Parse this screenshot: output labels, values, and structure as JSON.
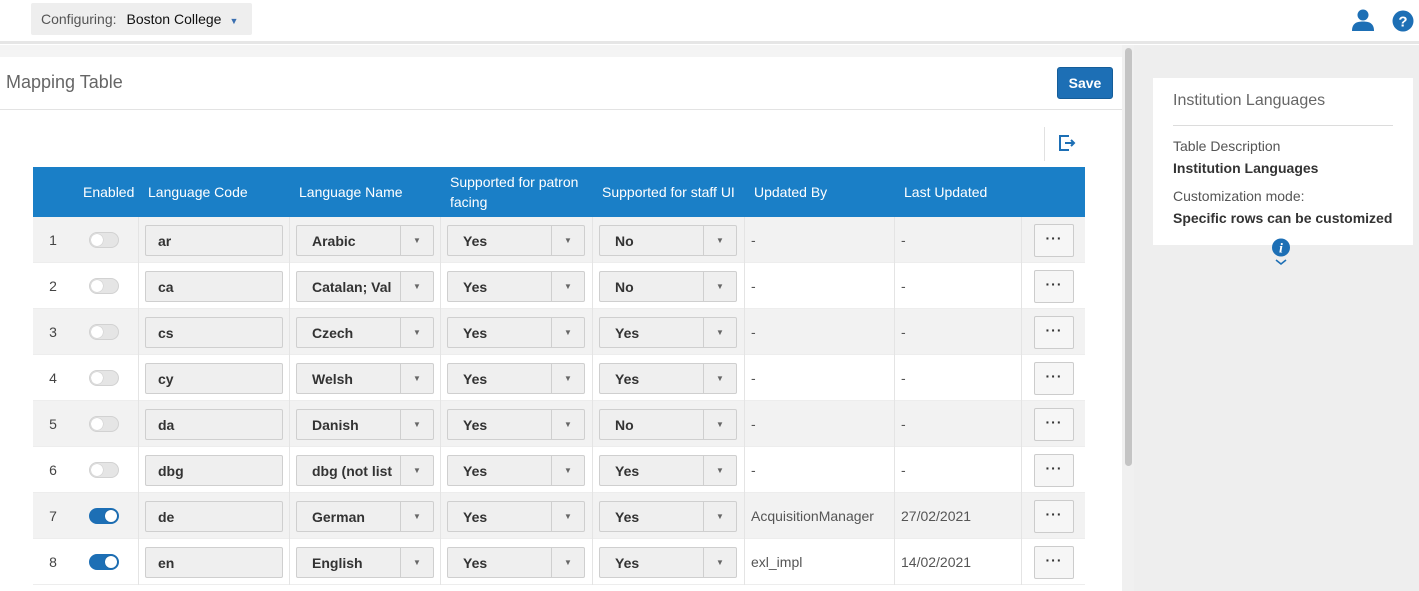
{
  "header": {
    "configuring_label": "Configuring:",
    "configuring_value": "Boston College",
    "caret": "▼",
    "user_icon": "user-icon",
    "help_icon": "help-icon"
  },
  "page": {
    "title": "Mapping Table",
    "save_label": "Save",
    "export_icon": "export-icon"
  },
  "table": {
    "columns": {
      "enabled": "Enabled",
      "code": "Language Code",
      "name": "Language Name",
      "patron": "Supported for patron facing",
      "staff": "Supported for staff UI",
      "updated_by": "Updated By",
      "last_updated": "Last Updated"
    },
    "rows": [
      {
        "num": "1",
        "enabled": false,
        "code": "ar",
        "name": "Arabic",
        "patron": "Yes",
        "staff": "No",
        "updated_by": "-",
        "last_updated": "-",
        "actions": "···"
      },
      {
        "num": "2",
        "enabled": false,
        "code": "ca",
        "name": "Catalan; Val",
        "patron": "Yes",
        "staff": "No",
        "updated_by": "-",
        "last_updated": "-",
        "actions": "···"
      },
      {
        "num": "3",
        "enabled": false,
        "code": "cs",
        "name": "Czech",
        "patron": "Yes",
        "staff": "Yes",
        "updated_by": "-",
        "last_updated": "-",
        "actions": "···"
      },
      {
        "num": "4",
        "enabled": false,
        "code": "cy",
        "name": "Welsh",
        "patron": "Yes",
        "staff": "Yes",
        "updated_by": "-",
        "last_updated": "-",
        "actions": "···"
      },
      {
        "num": "5",
        "enabled": false,
        "code": "da",
        "name": "Danish",
        "patron": "Yes",
        "staff": "No",
        "updated_by": "-",
        "last_updated": "-",
        "actions": "···"
      },
      {
        "num": "6",
        "enabled": false,
        "code": "dbg",
        "name": "dbg (not list",
        "patron": "Yes",
        "staff": "Yes",
        "updated_by": "-",
        "last_updated": "-",
        "actions": "···"
      },
      {
        "num": "7",
        "enabled": true,
        "code": "de",
        "name": "German",
        "patron": "Yes",
        "staff": "Yes",
        "updated_by": "AcquisitionManager",
        "last_updated": "27/02/2021",
        "actions": "···"
      },
      {
        "num": "8",
        "enabled": true,
        "code": "en",
        "name": "English",
        "patron": "Yes",
        "staff": "Yes",
        "updated_by": "exl_impl",
        "last_updated": "14/02/2021",
        "actions": "···"
      }
    ]
  },
  "panel": {
    "title": "Institution Languages",
    "desc_label": "Table Description",
    "desc_value": "Institution Languages",
    "mode_label": "Customization mode:",
    "mode_value": "Specific rows can be customized",
    "info_icon": "info-icon"
  },
  "colors": {
    "header_blue": "#1a7fc7",
    "accent_blue": "#1d6fb5",
    "panel_bg": "#eeeeee"
  }
}
